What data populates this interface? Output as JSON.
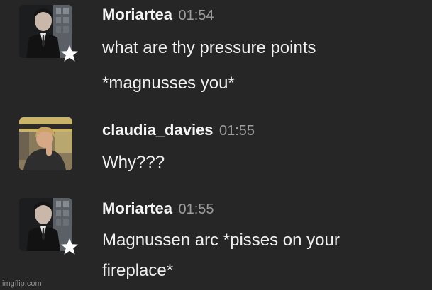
{
  "messages": [
    {
      "author": "Moriartea",
      "time": "01:54",
      "avatar_icon": "moriartea-avatar",
      "badge_icon": "star-icon",
      "lines": [
        "what are thy pressure points",
        "*magnusses you*"
      ]
    },
    {
      "author": "claudia_davies",
      "time": "01:55",
      "avatar_icon": "claudia-davies-avatar",
      "lines": [
        "Why???"
      ]
    },
    {
      "author": "Moriartea",
      "time": "01:55",
      "avatar_icon": "moriartea-avatar",
      "badge_icon": "star-icon",
      "lines": [
        "Magnussen arc *pisses on your",
        "fireplace*"
      ]
    }
  ],
  "watermark": "imgflip.com",
  "colors": {
    "background": "#262626",
    "author": "#f4f4f4",
    "timestamp": "#9d9d9d",
    "text": "#f0f0f0"
  }
}
